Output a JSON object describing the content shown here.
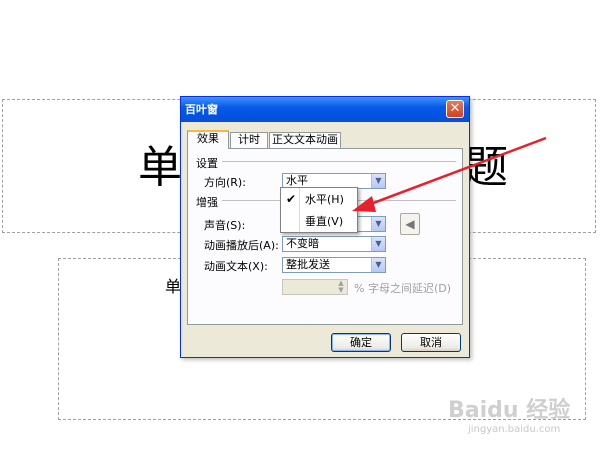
{
  "slide": {
    "title_left": "单",
    "title_right": "题",
    "body_fragment": "单"
  },
  "dialog": {
    "title": "百叶窗",
    "close_glyph": "✕",
    "tabs": [
      {
        "label": "效果",
        "active": true
      },
      {
        "label": "计时",
        "active": false
      },
      {
        "label": "正文文本动画",
        "active": false
      }
    ],
    "settings_section": "设置",
    "direction_label": "方向(R):",
    "direction_value": "水平",
    "enhance_section": "增强",
    "sound_label": "声音(S):",
    "after_animation_label": "动画播放后(A):",
    "after_animation_value": "不变暗",
    "animate_text_label": "动画文本(X):",
    "animate_text_value": "整批发送",
    "delay_label": "% 字母之间延迟(D)",
    "ok_label": "确定",
    "cancel_label": "取消"
  },
  "dropdown": {
    "options": [
      {
        "label": "水平(H)",
        "checked": true
      },
      {
        "label": "垂直(V)",
        "checked": false
      }
    ]
  },
  "watermark": {
    "brand": "Baidu 经验",
    "url": "jingyan.baidu.com"
  },
  "colors": {
    "titlebar": "#0054e3",
    "dialog_bg": "#ece9d8",
    "annotation_arrow": "#e8202a"
  }
}
